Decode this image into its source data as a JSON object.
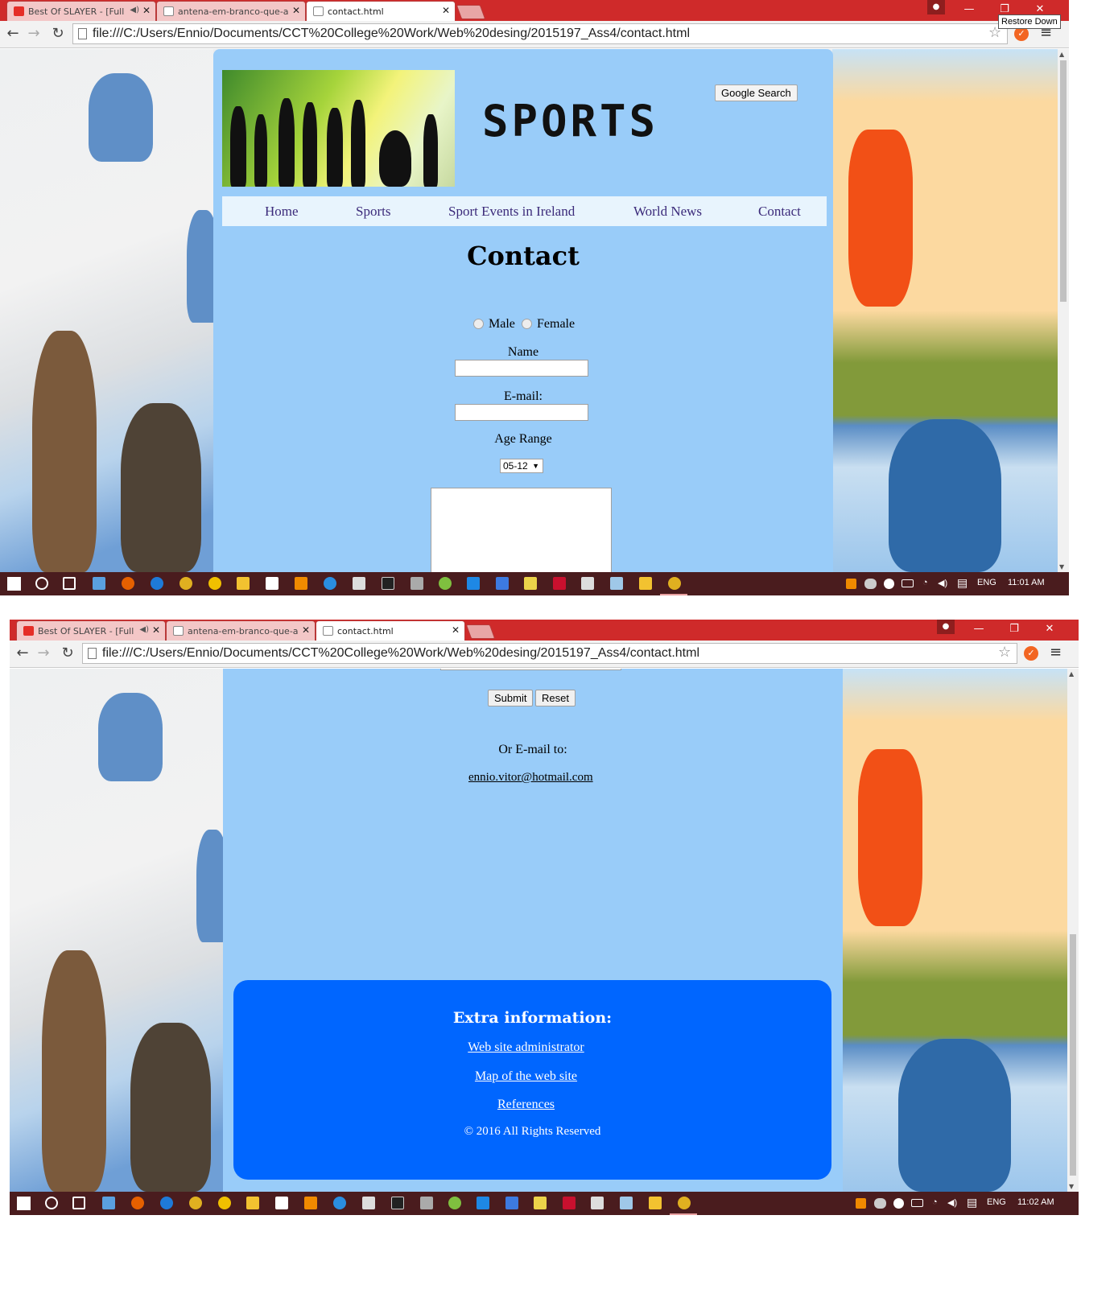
{
  "browser": {
    "tabs": [
      {
        "label": "Best Of SLAYER - [Full",
        "icon": "youtube-icon"
      },
      {
        "label": "antena-em-branco-que-a",
        "icon": "page-icon"
      },
      {
        "label": "contact.html",
        "icon": "page-icon"
      }
    ],
    "url": "file:///C:/Users/Ennio/Documents/CCT%20College%20Work/Web%20desing/2015197_Ass4/contact.html",
    "tooltip": "Restore Down"
  },
  "site": {
    "title": "SPORTS",
    "search_button": "Google Search",
    "nav": [
      "Home",
      "Sports",
      "Sport Events in Ireland",
      "World News",
      "Contact"
    ],
    "page_heading": "Contact"
  },
  "form": {
    "gender_options": [
      "Male",
      "Female"
    ],
    "name_label": "Name",
    "email_label": "E-mail:",
    "age_label": "Age Range",
    "age_selected": "05-12",
    "submit_label": "Submit",
    "reset_label": "Reset",
    "or_email_text": "Or E-mail to:",
    "email_address": "ennio.vitor@hotmail.com"
  },
  "footer": {
    "heading": "Extra information:",
    "links": [
      "Web site administrator",
      "Map of the web site",
      "References"
    ],
    "copyright": "© 2016 All Rights Reserved"
  },
  "taskbar": {
    "language": "ENG",
    "time_1": "11:01 AM",
    "time_2": "11:02 AM"
  },
  "colors": {
    "page_bg": "#99ccf9",
    "nav_bg": "#e8f4fd",
    "footer_bg": "#0066ff",
    "chrome_titlebar": "#cf2a2a",
    "taskbar": "#4a1c1e"
  }
}
